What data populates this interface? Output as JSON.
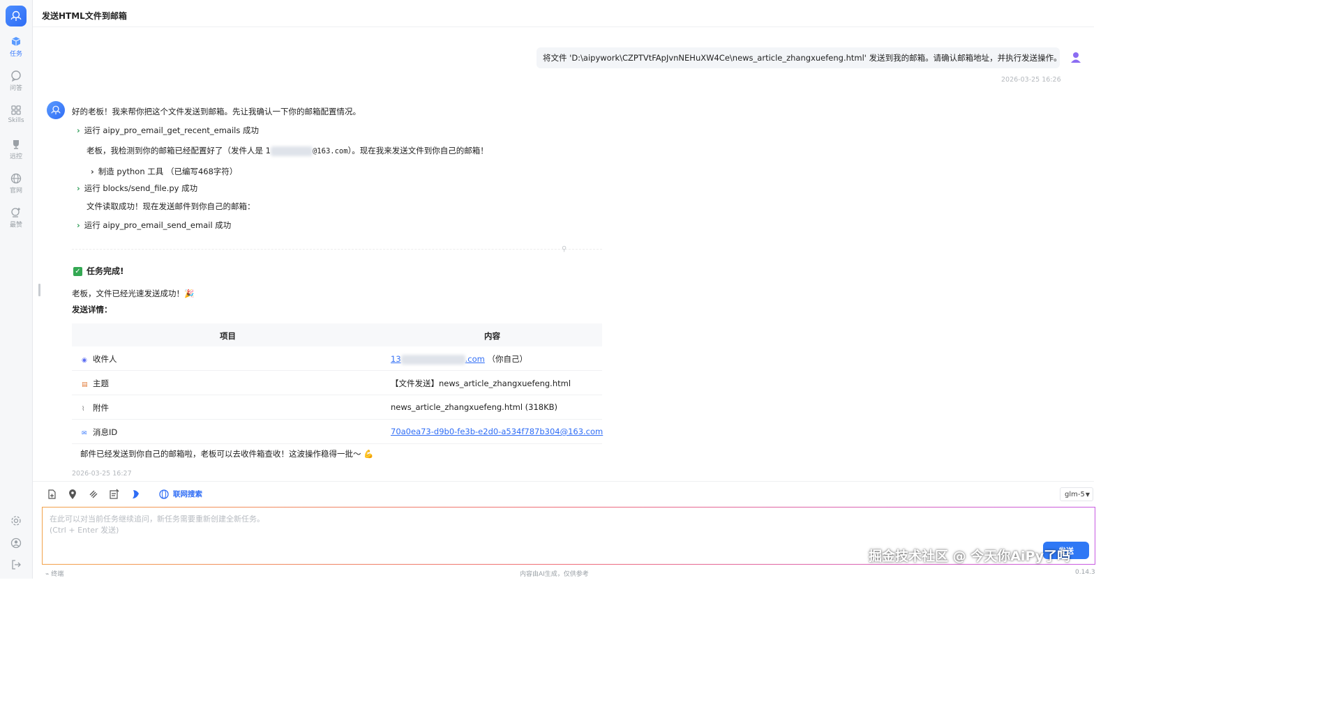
{
  "sidebar": {
    "items": [
      {
        "label": "任务",
        "icon": "cube-icon",
        "active": true
      },
      {
        "label": "问答",
        "icon": "chat-icon"
      },
      {
        "label": "Skills",
        "icon": "grid-icon"
      },
      {
        "label": "远控",
        "icon": "trophy-icon"
      },
      {
        "label": "官网",
        "icon": "globe-icon"
      },
      {
        "label": "最赞",
        "icon": "favorite-icon"
      }
    ]
  },
  "header": {
    "title": "发送HTML文件到邮箱"
  },
  "user_message": {
    "text": "将文件 'D:\\aipywork\\CZPTVtFApJvnNEHuXW4Ce\\news_article_zhangxuefeng.html' 发送到我的邮箱。请确认邮箱地址，并执行发送操作。",
    "time": "2026-03-25 16:26"
  },
  "assistant": {
    "intro": "好的老板！我来帮你把这个文件发送到邮箱。先让我确认一下你的邮箱配置情况。",
    "step1": "运行 aipy_pro_email_get_recent_emails 成功",
    "detect_prefix": "老板，我检测到你的邮箱已经配置好了（发件人是 1",
    "detect_domain": "@163.com",
    "detect_suffix": "）。现在我来发送文件到你自己的邮箱！",
    "tool_make": "制造 python 工具 （已编写468字符）",
    "step2": "运行 blocks/send_file.py 成功",
    "read_ok": "文件读取成功！现在发送邮件到你自己的邮箱：",
    "step3": "运行 aipy_pro_email_send_email 成功",
    "done_title": "任务完成!",
    "done_text": "老板，文件已经光速发送成功！🎉",
    "details_label": "发送详情：",
    "table": {
      "header_item": "项目",
      "header_content": "内容",
      "rows": [
        {
          "label": "收件人",
          "value_prefix": "13",
          "value_link_tail": ".com",
          "value_suffix": "（你自己）"
        },
        {
          "label": "主题",
          "value": "【文件发送】news_article_zhangxuefeng.html"
        },
        {
          "label": "附件",
          "value": "news_article_zhangxuefeng.html (318KB)"
        },
        {
          "label": "消息ID",
          "value": "70a0ea73-d9b0-fe3b-e2d0-a534f787b304@163.com"
        }
      ]
    },
    "closing": "邮件已经发送到你自己的邮箱啦，老板可以去收件箱查收！这波操作稳得一批～ 💪",
    "time": "2026-03-25 16:27"
  },
  "toolbar": {
    "web_search": "联网搜索",
    "model": "glm-5"
  },
  "input": {
    "placeholder": "在此可以对当前任务继续追问，新任务需要重新创建全新任务。\n(Ctrl + Enter 发送)"
  },
  "send_label": "发送",
  "watermark": "掘金技术社区 @ 今天你AiPy了吗",
  "footer": {
    "left": "终端",
    "center": "内容由AI生成，仅供参考",
    "version": "0.14.3"
  },
  "colors": {
    "accent": "#2f6df5",
    "success": "#34a853"
  }
}
